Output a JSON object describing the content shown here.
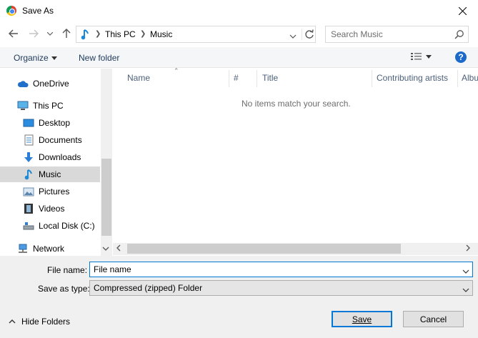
{
  "window": {
    "title": "Save As"
  },
  "address": {
    "crumbs": [
      "This PC",
      "Music"
    ]
  },
  "search": {
    "placeholder": "Search Music"
  },
  "toolbar": {
    "organize_label": "Organize",
    "new_folder_label": "New folder"
  },
  "nav": {
    "items": [
      {
        "label": "OneDrive",
        "icon": "cloud-icon"
      },
      {
        "label": "This PC",
        "icon": "computer-icon"
      },
      {
        "label": "Desktop",
        "icon": "desktop-icon"
      },
      {
        "label": "Documents",
        "icon": "documents-icon"
      },
      {
        "label": "Downloads",
        "icon": "download-icon"
      },
      {
        "label": "Music",
        "icon": "music-icon",
        "selected": true
      },
      {
        "label": "Pictures",
        "icon": "pictures-icon"
      },
      {
        "label": "Videos",
        "icon": "videos-icon"
      },
      {
        "label": "Local Disk (C:)",
        "icon": "disk-icon"
      },
      {
        "label": "Network",
        "icon": "network-icon"
      }
    ]
  },
  "columns": [
    "Name",
    "#",
    "Title",
    "Contributing artists",
    "Album"
  ],
  "empty_message": "No items match your search.",
  "form": {
    "file_name_label": "File name:",
    "file_name_value": "File name",
    "save_type_label": "Save as type:",
    "save_type_value": "Compressed (zipped) Folder"
  },
  "footer": {
    "hide_folders_label": "Hide Folders",
    "save_label": "Save",
    "cancel_label": "Cancel"
  },
  "colors": {
    "accent": "#0078d7",
    "selected_nav": "#d9d9d9",
    "header_text": "#4c607a",
    "link_text": "#1e395b"
  }
}
